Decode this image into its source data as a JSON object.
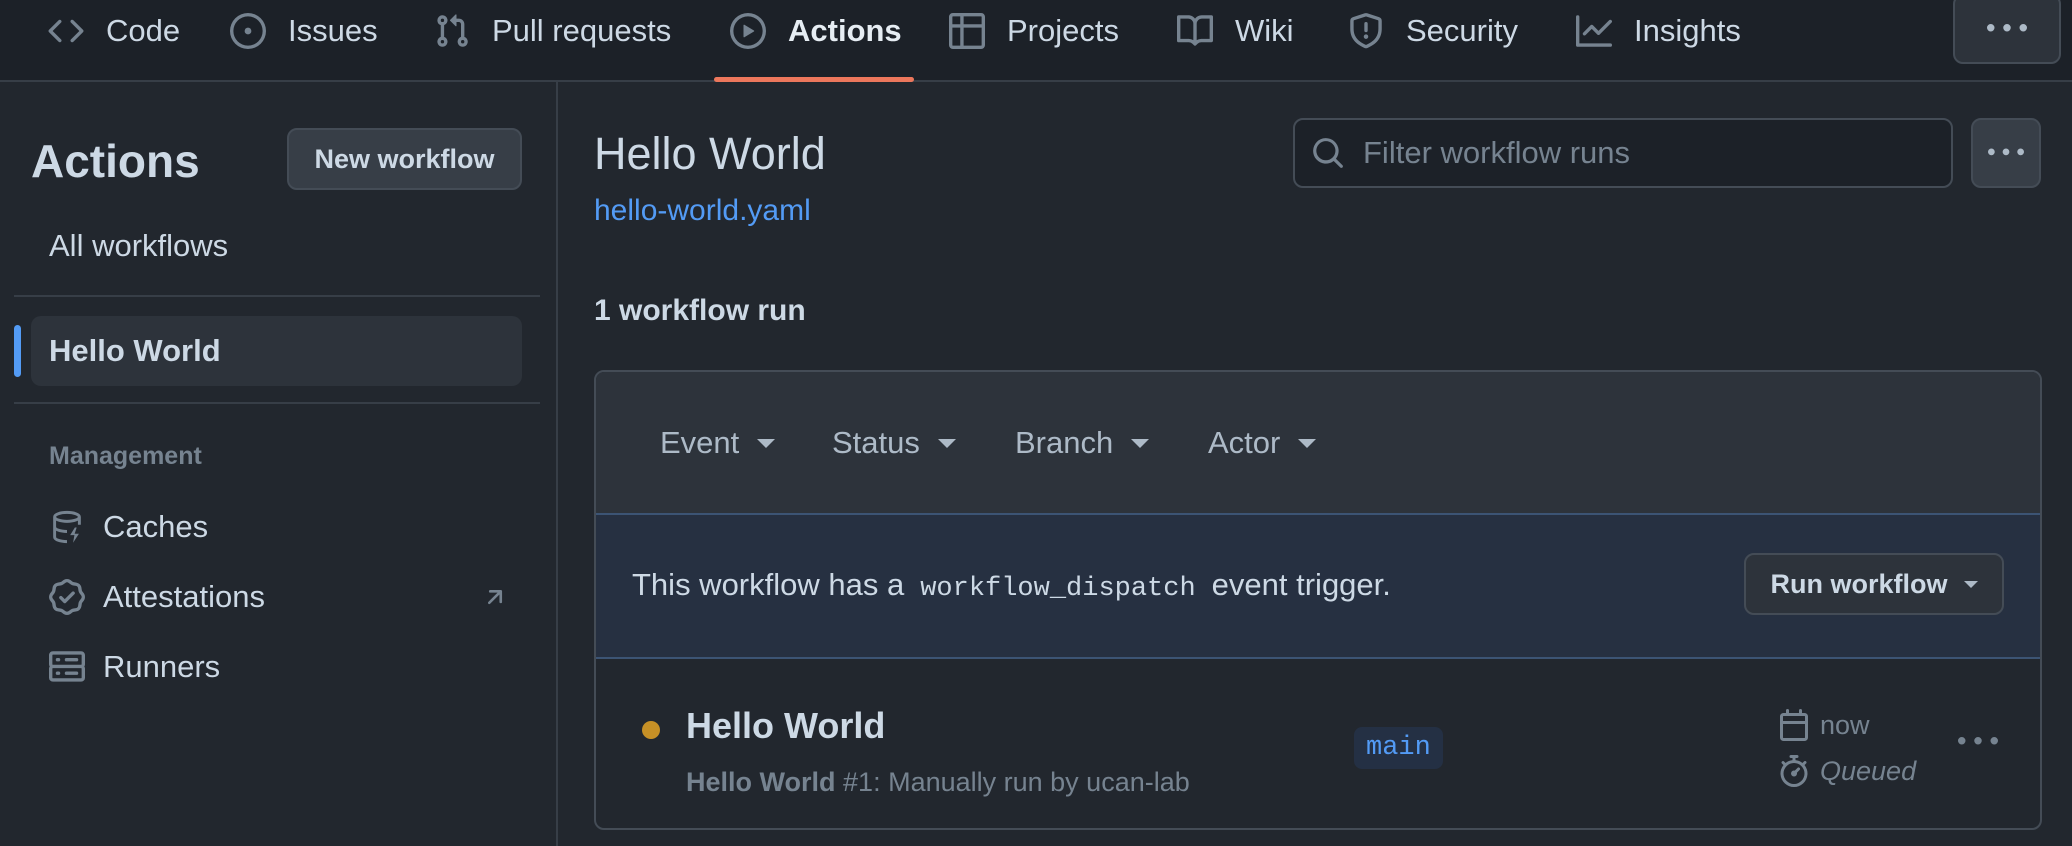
{
  "repo_nav": {
    "tabs": [
      {
        "label": "Code",
        "icon": "code-icon"
      },
      {
        "label": "Issues",
        "icon": "issue-opened-icon"
      },
      {
        "label": "Pull requests",
        "icon": "git-pull-request-icon"
      },
      {
        "label": "Actions",
        "icon": "play-icon",
        "active": true
      },
      {
        "label": "Projects",
        "icon": "table-icon"
      },
      {
        "label": "Wiki",
        "icon": "book-icon"
      },
      {
        "label": "Security",
        "icon": "shield-icon"
      },
      {
        "label": "Insights",
        "icon": "graph-icon"
      }
    ],
    "more_icon": "kebab-horizontal-icon",
    "active_underline_color": "#ec775c"
  },
  "sidebar": {
    "title": "Actions",
    "new_workflow_label": "New workflow",
    "all_workflows_label": "All workflows",
    "selected_workflow": "Hello World",
    "management_heading": "Management",
    "management_items": [
      {
        "label": "Caches",
        "icon": "database-icon"
      },
      {
        "label": "Attestations",
        "icon": "verified-icon",
        "external": true
      },
      {
        "label": "Runners",
        "icon": "server-icon"
      }
    ]
  },
  "main": {
    "title": "Hello World",
    "file_link": "hello-world.yaml",
    "filter_placeholder": "Filter workflow runs",
    "run_count": "1 workflow run",
    "filters": [
      "Event",
      "Status",
      "Branch",
      "Actor"
    ],
    "dispatch": {
      "prefix": "This workflow has a",
      "code": "workflow_dispatch",
      "suffix": "event trigger.",
      "button": "Run workflow"
    },
    "runs": [
      {
        "title": "Hello World",
        "workflow_name": "Hello World",
        "run_number": "#1",
        "description": ": Manually run by ucan-lab",
        "branch": "main",
        "when": "now",
        "status": "Queued",
        "status_color": "#c69026"
      }
    ]
  },
  "colors": {
    "background": "#22272e",
    "accent_link": "#539bf5",
    "selected_indicator": "#539bf5"
  }
}
